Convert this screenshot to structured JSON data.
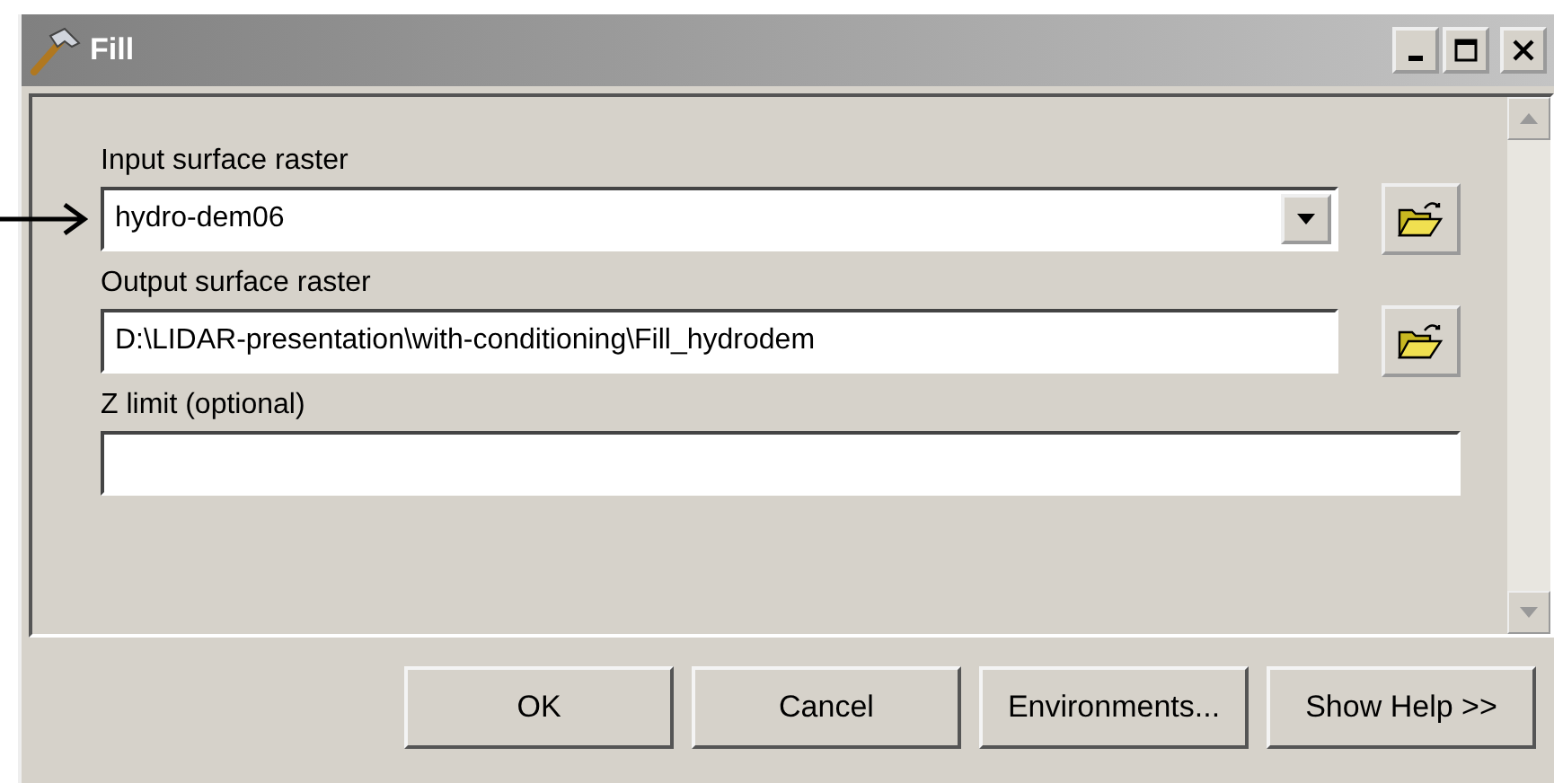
{
  "window": {
    "title": "Fill"
  },
  "fields": [
    {
      "label": "Input surface raster",
      "kind": "dropdown",
      "value": "hydro-dem06",
      "browse": true,
      "pointed": true
    },
    {
      "label": "Output surface raster",
      "kind": "text",
      "value": "D:\\LIDAR-presentation\\with-conditioning\\Fill_hydrodem",
      "browse": true,
      "pointed": false
    },
    {
      "label": "Z limit (optional)",
      "kind": "text",
      "browse": false,
      "pointed": false
    }
  ],
  "buttons": [
    "OK",
    "Cancel",
    "Environments...",
    "Show Help >>"
  ]
}
